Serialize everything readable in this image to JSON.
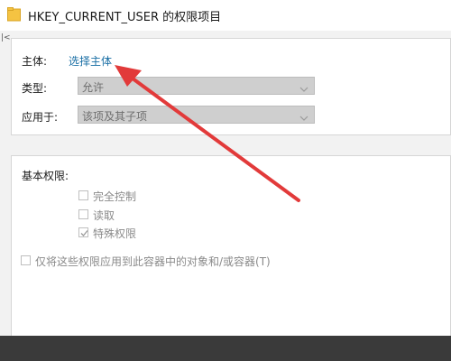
{
  "window": {
    "title": "HKEY_CURRENT_USER 的权限项目",
    "icon": "folder-icon",
    "side_mark": "|<"
  },
  "principal": {
    "label": "主体:",
    "link": "选择主体"
  },
  "type": {
    "label": "类型:",
    "value": "允许"
  },
  "applies_to": {
    "label": "应用于:",
    "value": "该项及其子项"
  },
  "basic_permissions": {
    "label": "基本权限:",
    "items": [
      {
        "label": "完全控制",
        "checked": false
      },
      {
        "label": "读取",
        "checked": false
      },
      {
        "label": "特殊权限",
        "checked": true
      }
    ],
    "apply_only_label": "仅将这些权限应用到此容器中的对象和/或容器(T)"
  },
  "colors": {
    "accent_link": "#1a6fa5",
    "annotation_arrow": "#e23a3a",
    "disabled_select": "#cfcfcf"
  }
}
